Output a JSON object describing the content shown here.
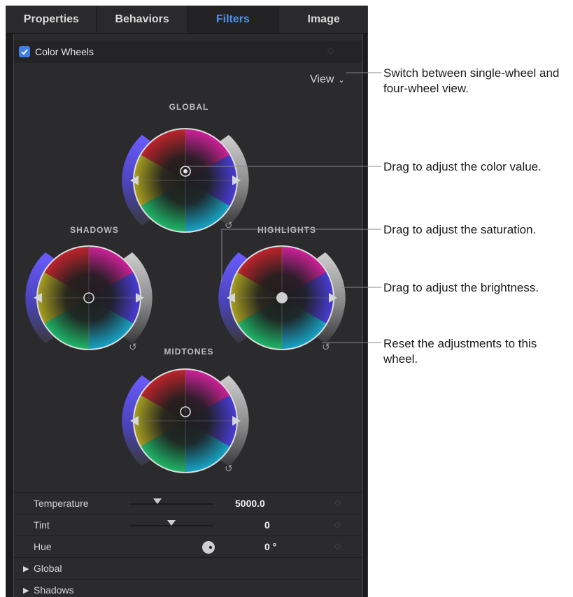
{
  "tabs": [
    {
      "label": "Properties",
      "active": false
    },
    {
      "label": "Behaviors",
      "active": false
    },
    {
      "label": "Filters",
      "active": true
    },
    {
      "label": "Image",
      "active": false
    }
  ],
  "filter": {
    "name": "Color Wheels",
    "enabled": true
  },
  "view_button": {
    "label": "View"
  },
  "wheels": {
    "global": "GLOBAL",
    "shadows": "SHADOWS",
    "highlights": "HIGHLIGHTS",
    "midtones": "MIDTONES"
  },
  "params": {
    "temperature": {
      "label": "Temperature",
      "value": "5000.0",
      "slider_fraction": 0.33
    },
    "tint": {
      "label": "Tint",
      "value": "0",
      "slider_fraction": 0.5
    },
    "hue": {
      "label": "Hue",
      "value": "0 °"
    }
  },
  "groups": [
    {
      "label": "Global"
    },
    {
      "label": "Shadows"
    }
  ],
  "callouts": {
    "view": "Switch between single-wheel and four-wheel view.",
    "color": "Drag to adjust the color value.",
    "saturation": "Drag to adjust the saturation.",
    "brightness": "Drag to adjust the brightness.",
    "reset": "Reset the adjustments to this wheel."
  },
  "colors": {
    "accent": "#4d8cff",
    "checkbox": "#3f7fe8",
    "saturation_arc": "#5b52d6",
    "brightness_arc": "#9a9a9a"
  }
}
